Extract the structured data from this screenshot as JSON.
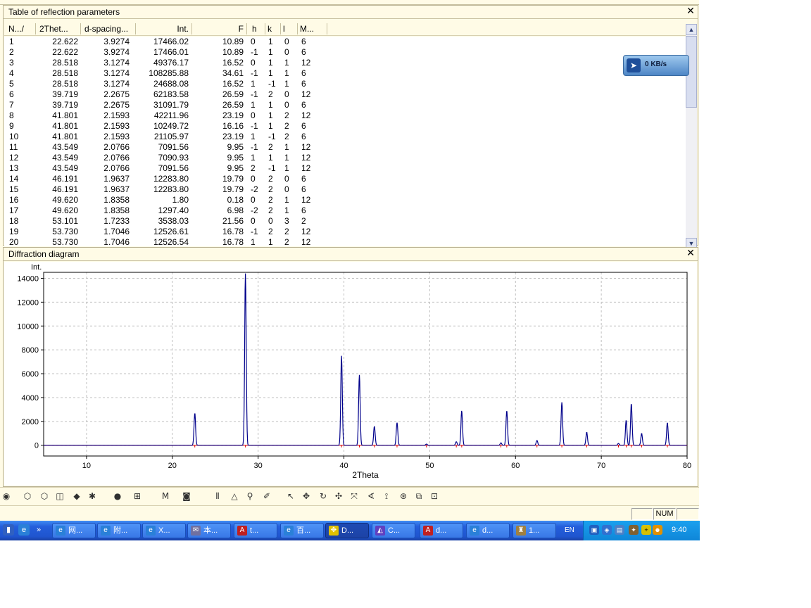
{
  "table_panel": {
    "title": "Table of reflection parameters",
    "close_label": "✕",
    "columns": [
      "N.../",
      "2Thet...",
      "d-spacing...",
      "Int.",
      "F",
      "h",
      "k",
      "l",
      "M..."
    ],
    "rows": [
      [
        "1",
        "22.622",
        "3.9274",
        "17466.02",
        "10.89",
        "0",
        "1",
        "0",
        "6"
      ],
      [
        "2",
        "22.622",
        "3.9274",
        "17466.01",
        "10.89",
        "-1",
        "1",
        "0",
        "6"
      ],
      [
        "3",
        "28.518",
        "3.1274",
        "49376.17",
        "16.52",
        "0",
        "1",
        "1",
        "12"
      ],
      [
        "4",
        "28.518",
        "3.1274",
        "108285.88",
        "34.61",
        "-1",
        "1",
        "1",
        "6"
      ],
      [
        "5",
        "28.518",
        "3.1274",
        "24688.08",
        "16.52",
        "1",
        "-1",
        "1",
        "6"
      ],
      [
        "6",
        "39.719",
        "2.2675",
        "62183.58",
        "26.59",
        "-1",
        "2",
        "0",
        "12"
      ],
      [
        "7",
        "39.719",
        "2.2675",
        "31091.79",
        "26.59",
        "1",
        "1",
        "0",
        "6"
      ],
      [
        "8",
        "41.801",
        "2.1593",
        "42211.96",
        "23.19",
        "0",
        "1",
        "2",
        "12"
      ],
      [
        "9",
        "41.801",
        "2.1593",
        "10249.72",
        "16.16",
        "-1",
        "1",
        "2",
        "6"
      ],
      [
        "10",
        "41.801",
        "2.1593",
        "21105.97",
        "23.19",
        "1",
        "-1",
        "2",
        "6"
      ],
      [
        "11",
        "43.549",
        "2.0766",
        "7091.56",
        "9.95",
        "-1",
        "2",
        "1",
        "12"
      ],
      [
        "12",
        "43.549",
        "2.0766",
        "7090.93",
        "9.95",
        "1",
        "1",
        "1",
        "12"
      ],
      [
        "13",
        "43.549",
        "2.0766",
        "7091.56",
        "9.95",
        "2",
        "-1",
        "1",
        "12"
      ],
      [
        "14",
        "46.191",
        "1.9637",
        "12283.80",
        "19.79",
        "0",
        "2",
        "0",
        "6"
      ],
      [
        "15",
        "46.191",
        "1.9637",
        "12283.80",
        "19.79",
        "-2",
        "2",
        "0",
        "6"
      ],
      [
        "16",
        "49.620",
        "1.8358",
        "1.80",
        "0.18",
        "0",
        "2",
        "1",
        "12"
      ],
      [
        "17",
        "49.620",
        "1.8358",
        "1297.40",
        "6.98",
        "-2",
        "2",
        "1",
        "6"
      ],
      [
        "18",
        "53.101",
        "1.7233",
        "3538.03",
        "21.56",
        "0",
        "0",
        "3",
        "2"
      ],
      [
        "19",
        "53.730",
        "1.7046",
        "12526.61",
        "16.78",
        "-1",
        "2",
        "2",
        "12"
      ],
      [
        "20",
        "53.730",
        "1.7046",
        "12526.54",
        "16.78",
        "1",
        "1",
        "2",
        "12"
      ]
    ]
  },
  "speed_widget": {
    "value": "0 KB/s"
  },
  "chart_panel": {
    "title": "Diffraction diagram",
    "close_label": "✕"
  },
  "chart_data": {
    "type": "line",
    "xlabel": "2Theta",
    "ylabel": "Int.",
    "xlim": [
      5,
      80
    ],
    "ylim": [
      -900,
      14500
    ],
    "x_ticks": [
      10,
      20,
      30,
      40,
      50,
      60,
      70,
      80
    ],
    "y_ticks": [
      0,
      2000,
      4000,
      6000,
      8000,
      10000,
      12000,
      14000
    ],
    "grid": true,
    "series": [
      {
        "color": "#00008b",
        "peaks": [
          {
            "x": 22.62,
            "y": 2700
          },
          {
            "x": 28.52,
            "y": 14400
          },
          {
            "x": 39.72,
            "y": 7500
          },
          {
            "x": 41.8,
            "y": 5900
          },
          {
            "x": 43.55,
            "y": 1600
          },
          {
            "x": 46.19,
            "y": 1900
          },
          {
            "x": 49.62,
            "y": 100
          },
          {
            "x": 53.1,
            "y": 300
          },
          {
            "x": 53.73,
            "y": 2900
          },
          {
            "x": 58.3,
            "y": 200
          },
          {
            "x": 58.98,
            "y": 2900
          },
          {
            "x": 62.5,
            "y": 400
          },
          {
            "x": 65.4,
            "y": 3600
          },
          {
            "x": 68.3,
            "y": 1100
          },
          {
            "x": 72.0,
            "y": 150
          },
          {
            "x": 72.9,
            "y": 2100
          },
          {
            "x": 73.5,
            "y": 3500
          },
          {
            "x": 74.7,
            "y": 1000
          },
          {
            "x": 77.7,
            "y": 1900
          }
        ]
      },
      {
        "color": "#dd0000",
        "baseline": 0
      }
    ]
  },
  "toolbar": {
    "icons": [
      "circle-tool-icon",
      "hexagon-icon",
      "hexagon-outline-icon",
      "cube-icon",
      "diamond-icon",
      "molecule-icon",
      "fe-atom-icon",
      "grid-icon",
      "m-icon",
      "rotate-model-icon",
      "bars-icon",
      "triangle-icon",
      "bond-icon",
      "eraser-icon",
      "cursor-icon",
      "move-icon",
      "rotate-icon",
      "pan-icon",
      "fit-icon",
      "angle-icon",
      "tripod-icon",
      "measure-icon",
      "torsion-icon",
      "label-icon"
    ]
  },
  "statusbar": {
    "num": "NUM"
  },
  "taskbar": {
    "buttons": [
      "网...",
      "附...",
      "X...",
      "本...",
      "t...",
      "百...",
      "D...",
      "C...",
      "d...",
      "d...",
      "1..."
    ],
    "lang": "EN",
    "clock": "9:40"
  }
}
